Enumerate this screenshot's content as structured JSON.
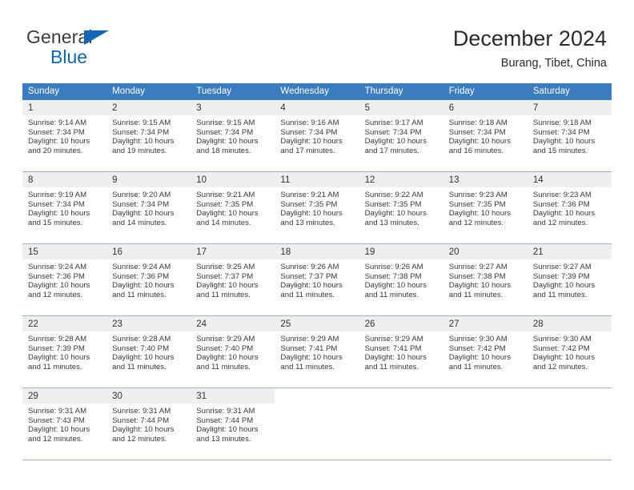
{
  "brand": {
    "line1": "General",
    "line2": "Blue",
    "accent_color": "#1267b2"
  },
  "header": {
    "title": "December 2024",
    "location": "Burang, Tibet, China"
  },
  "calendar": {
    "header_bg": "#3a7cbe",
    "daynum_bg": "#efefef",
    "weekday_headers": [
      "Sunday",
      "Monday",
      "Tuesday",
      "Wednesday",
      "Thursday",
      "Friday",
      "Saturday"
    ],
    "weeks": [
      [
        {
          "day": "1",
          "sunrise": "Sunrise: 9:14 AM",
          "sunset": "Sunset: 7:34 PM",
          "daylight1": "Daylight: 10 hours",
          "daylight2": "and 20 minutes."
        },
        {
          "day": "2",
          "sunrise": "Sunrise: 9:15 AM",
          "sunset": "Sunset: 7:34 PM",
          "daylight1": "Daylight: 10 hours",
          "daylight2": "and 19 minutes."
        },
        {
          "day": "3",
          "sunrise": "Sunrise: 9:15 AM",
          "sunset": "Sunset: 7:34 PM",
          "daylight1": "Daylight: 10 hours",
          "daylight2": "and 18 minutes."
        },
        {
          "day": "4",
          "sunrise": "Sunrise: 9:16 AM",
          "sunset": "Sunset: 7:34 PM",
          "daylight1": "Daylight: 10 hours",
          "daylight2": "and 17 minutes."
        },
        {
          "day": "5",
          "sunrise": "Sunrise: 9:17 AM",
          "sunset": "Sunset: 7:34 PM",
          "daylight1": "Daylight: 10 hours",
          "daylight2": "and 17 minutes."
        },
        {
          "day": "6",
          "sunrise": "Sunrise: 9:18 AM",
          "sunset": "Sunset: 7:34 PM",
          "daylight1": "Daylight: 10 hours",
          "daylight2": "and 16 minutes."
        },
        {
          "day": "7",
          "sunrise": "Sunrise: 9:18 AM",
          "sunset": "Sunset: 7:34 PM",
          "daylight1": "Daylight: 10 hours",
          "daylight2": "and 15 minutes."
        }
      ],
      [
        {
          "day": "8",
          "sunrise": "Sunrise: 9:19 AM",
          "sunset": "Sunset: 7:34 PM",
          "daylight1": "Daylight: 10 hours",
          "daylight2": "and 15 minutes."
        },
        {
          "day": "9",
          "sunrise": "Sunrise: 9:20 AM",
          "sunset": "Sunset: 7:34 PM",
          "daylight1": "Daylight: 10 hours",
          "daylight2": "and 14 minutes."
        },
        {
          "day": "10",
          "sunrise": "Sunrise: 9:21 AM",
          "sunset": "Sunset: 7:35 PM",
          "daylight1": "Daylight: 10 hours",
          "daylight2": "and 14 minutes."
        },
        {
          "day": "11",
          "sunrise": "Sunrise: 9:21 AM",
          "sunset": "Sunset: 7:35 PM",
          "daylight1": "Daylight: 10 hours",
          "daylight2": "and 13 minutes."
        },
        {
          "day": "12",
          "sunrise": "Sunrise: 9:22 AM",
          "sunset": "Sunset: 7:35 PM",
          "daylight1": "Daylight: 10 hours",
          "daylight2": "and 13 minutes."
        },
        {
          "day": "13",
          "sunrise": "Sunrise: 9:23 AM",
          "sunset": "Sunset: 7:35 PM",
          "daylight1": "Daylight: 10 hours",
          "daylight2": "and 12 minutes."
        },
        {
          "day": "14",
          "sunrise": "Sunrise: 9:23 AM",
          "sunset": "Sunset: 7:36 PM",
          "daylight1": "Daylight: 10 hours",
          "daylight2": "and 12 minutes."
        }
      ],
      [
        {
          "day": "15",
          "sunrise": "Sunrise: 9:24 AM",
          "sunset": "Sunset: 7:36 PM",
          "daylight1": "Daylight: 10 hours",
          "daylight2": "and 12 minutes."
        },
        {
          "day": "16",
          "sunrise": "Sunrise: 9:24 AM",
          "sunset": "Sunset: 7:36 PM",
          "daylight1": "Daylight: 10 hours",
          "daylight2": "and 11 minutes."
        },
        {
          "day": "17",
          "sunrise": "Sunrise: 9:25 AM",
          "sunset": "Sunset: 7:37 PM",
          "daylight1": "Daylight: 10 hours",
          "daylight2": "and 11 minutes."
        },
        {
          "day": "18",
          "sunrise": "Sunrise: 9:26 AM",
          "sunset": "Sunset: 7:37 PM",
          "daylight1": "Daylight: 10 hours",
          "daylight2": "and 11 minutes."
        },
        {
          "day": "19",
          "sunrise": "Sunrise: 9:26 AM",
          "sunset": "Sunset: 7:38 PM",
          "daylight1": "Daylight: 10 hours",
          "daylight2": "and 11 minutes."
        },
        {
          "day": "20",
          "sunrise": "Sunrise: 9:27 AM",
          "sunset": "Sunset: 7:38 PM",
          "daylight1": "Daylight: 10 hours",
          "daylight2": "and 11 minutes."
        },
        {
          "day": "21",
          "sunrise": "Sunrise: 9:27 AM",
          "sunset": "Sunset: 7:39 PM",
          "daylight1": "Daylight: 10 hours",
          "daylight2": "and 11 minutes."
        }
      ],
      [
        {
          "day": "22",
          "sunrise": "Sunrise: 9:28 AM",
          "sunset": "Sunset: 7:39 PM",
          "daylight1": "Daylight: 10 hours",
          "daylight2": "and 11 minutes."
        },
        {
          "day": "23",
          "sunrise": "Sunrise: 9:28 AM",
          "sunset": "Sunset: 7:40 PM",
          "daylight1": "Daylight: 10 hours",
          "daylight2": "and 11 minutes."
        },
        {
          "day": "24",
          "sunrise": "Sunrise: 9:29 AM",
          "sunset": "Sunset: 7:40 PM",
          "daylight1": "Daylight: 10 hours",
          "daylight2": "and 11 minutes."
        },
        {
          "day": "25",
          "sunrise": "Sunrise: 9:29 AM",
          "sunset": "Sunset: 7:41 PM",
          "daylight1": "Daylight: 10 hours",
          "daylight2": "and 11 minutes."
        },
        {
          "day": "26",
          "sunrise": "Sunrise: 9:29 AM",
          "sunset": "Sunset: 7:41 PM",
          "daylight1": "Daylight: 10 hours",
          "daylight2": "and 11 minutes."
        },
        {
          "day": "27",
          "sunrise": "Sunrise: 9:30 AM",
          "sunset": "Sunset: 7:42 PM",
          "daylight1": "Daylight: 10 hours",
          "daylight2": "and 11 minutes."
        },
        {
          "day": "28",
          "sunrise": "Sunrise: 9:30 AM",
          "sunset": "Sunset: 7:42 PM",
          "daylight1": "Daylight: 10 hours",
          "daylight2": "and 12 minutes."
        }
      ],
      [
        {
          "day": "29",
          "sunrise": "Sunrise: 9:31 AM",
          "sunset": "Sunset: 7:43 PM",
          "daylight1": "Daylight: 10 hours",
          "daylight2": "and 12 minutes."
        },
        {
          "day": "30",
          "sunrise": "Sunrise: 9:31 AM",
          "sunset": "Sunset: 7:44 PM",
          "daylight1": "Daylight: 10 hours",
          "daylight2": "and 12 minutes."
        },
        {
          "day": "31",
          "sunrise": "Sunrise: 9:31 AM",
          "sunset": "Sunset: 7:44 PM",
          "daylight1": "Daylight: 10 hours",
          "daylight2": "and 13 minutes."
        },
        {
          "day": "",
          "sunrise": "",
          "sunset": "",
          "daylight1": "",
          "daylight2": ""
        },
        {
          "day": "",
          "sunrise": "",
          "sunset": "",
          "daylight1": "",
          "daylight2": ""
        },
        {
          "day": "",
          "sunrise": "",
          "sunset": "",
          "daylight1": "",
          "daylight2": ""
        },
        {
          "day": "",
          "sunrise": "",
          "sunset": "",
          "daylight1": "",
          "daylight2": ""
        }
      ]
    ]
  }
}
